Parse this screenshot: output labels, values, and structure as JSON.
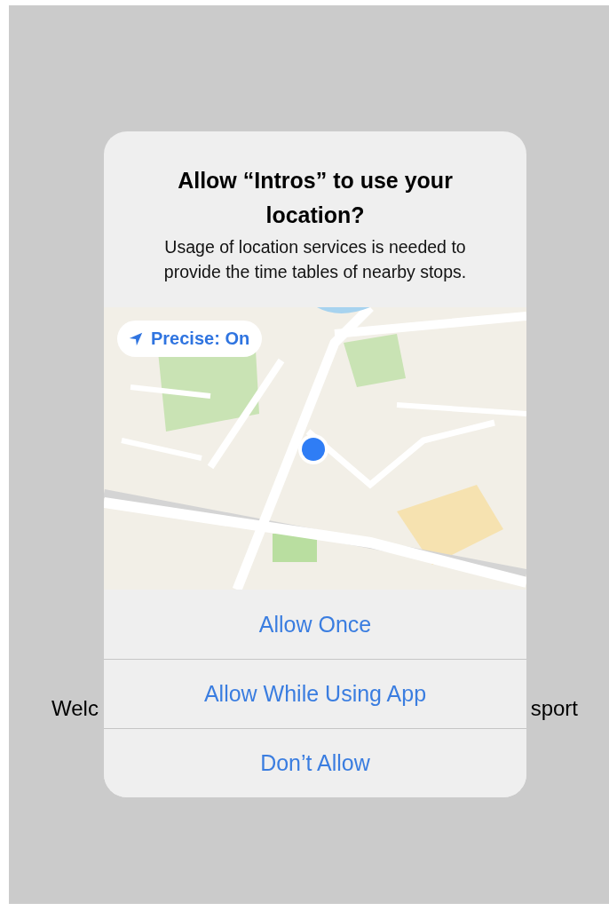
{
  "background": {
    "texts": [
      "Welc",
      "sport"
    ]
  },
  "dialog": {
    "title": "Allow “Intros” to use your location?",
    "message": "Usage of location services is needed to provide the time tables of nearby stops.",
    "map": {
      "kind": "picture",
      "precise_button": {
        "label": "Precise: On"
      }
    },
    "buttons": [
      {
        "label": "Allow Once"
      },
      {
        "label": "Allow While Using App"
      },
      {
        "label": "Don’t Allow"
      }
    ]
  }
}
